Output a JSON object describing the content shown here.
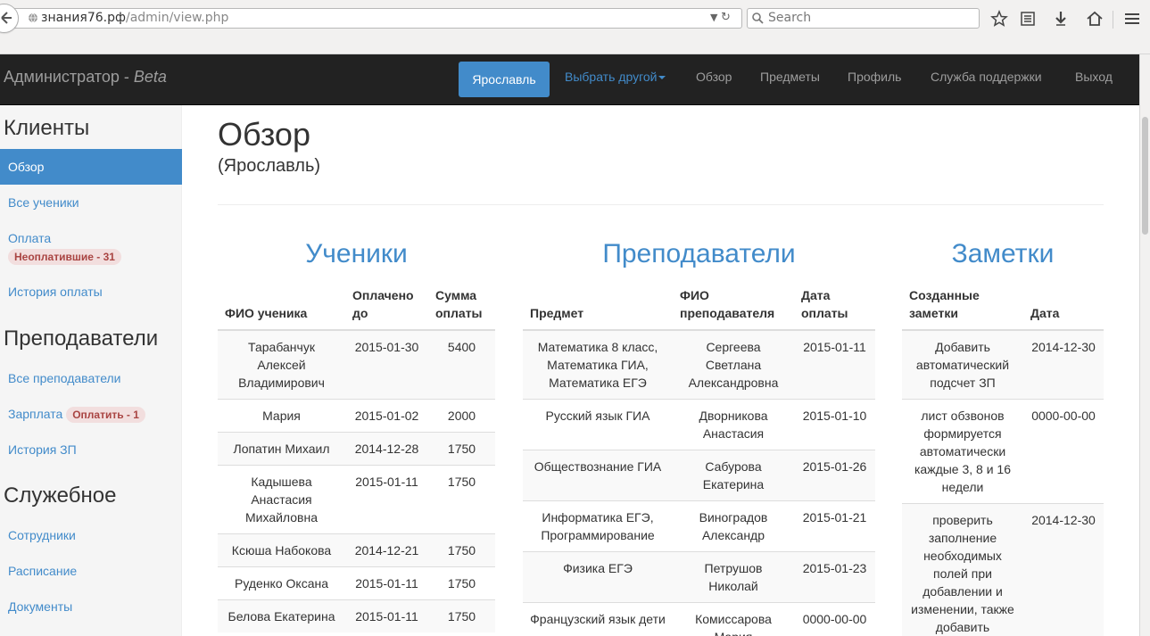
{
  "browser": {
    "url_host": "знания76.рф",
    "url_path": "/admin/view.php",
    "search_placeholder": "Search"
  },
  "navbar": {
    "brand": "Администратор - ",
    "brand_beta": "Beta",
    "active_city": "Ярославль",
    "choose_other": "Выбрать другой",
    "items": [
      "Обзор",
      "Предметы",
      "Профиль",
      "Служба поддержки",
      "Выход"
    ]
  },
  "sidebar": {
    "clients_heading": "Клиенты",
    "clients_items": [
      "Обзор",
      "Все ученики",
      "Оплата",
      "История оплаты"
    ],
    "unpaid_badge": "Неоплатившие - 31",
    "teachers_heading": "Преподаватели",
    "teachers_items": [
      "Все преподаватели",
      "Зарплата",
      "История ЗП"
    ],
    "pay_badge": "Оплатить - 1",
    "service_heading": "Служебное",
    "service_items": [
      "Сотрудники",
      "Расписание",
      "Документы"
    ]
  },
  "main": {
    "title": "Обзор",
    "subtitle": "(Ярославль)",
    "students": {
      "heading": "Ученики",
      "columns": [
        "ФИО ученика",
        "Оплачено до",
        "Сумма оплаты"
      ],
      "rows": [
        [
          "Тарабанчук Алексей Владимирович",
          "2015-01-30",
          "5400"
        ],
        [
          "Мария",
          "2015-01-02",
          "2000"
        ],
        [
          "Лопатин Михаил",
          "2014-12-28",
          "1750"
        ],
        [
          "Кадышева Анастасия Михайловна",
          "2015-01-11",
          "1750"
        ],
        [
          "Ксюша Набокова",
          "2014-12-21",
          "1750"
        ],
        [
          "Руденко Оксана",
          "2015-01-11",
          "1750"
        ],
        [
          "Белова Екатерина",
          "2015-01-11",
          "1750"
        ]
      ]
    },
    "teachers": {
      "heading": "Преподаватели",
      "columns": [
        "Предмет",
        "ФИО преподавателя",
        "Дата оплаты"
      ],
      "rows": [
        [
          "Математика 8 класс, Математика ГИА, Математика ЕГЭ",
          "Сергеева Светлана Александровна",
          "2015-01-11"
        ],
        [
          "Русский язык ГИА",
          "Дворникова Анастасия",
          "2015-01-10"
        ],
        [
          "Обществознание ГИА",
          "Сабурова Екатерина",
          "2015-01-26"
        ],
        [
          "Информатика ЕГЭ, Программирование",
          "Виноградов Александр",
          "2015-01-21"
        ],
        [
          "Физика ЕГЭ",
          "Петрушов Николай",
          "2015-01-23"
        ],
        [
          "Французский язык дети",
          "Комиссарова Мария",
          "0000-00-00"
        ]
      ]
    },
    "notes": {
      "heading": "Заметки",
      "columns": [
        "Созданные заметки",
        "Дата"
      ],
      "rows": [
        [
          "Добавить автоматический подсчет ЗП",
          "2014-12-30"
        ],
        [
          "лист обзвонов формируется автоматически каждые 3, 8 и 16 недели",
          "0000-00-00"
        ],
        [
          "проверить заполнение необходимых полей при добавлении и изменении, также добавить",
          "2014-12-30"
        ]
      ]
    }
  }
}
